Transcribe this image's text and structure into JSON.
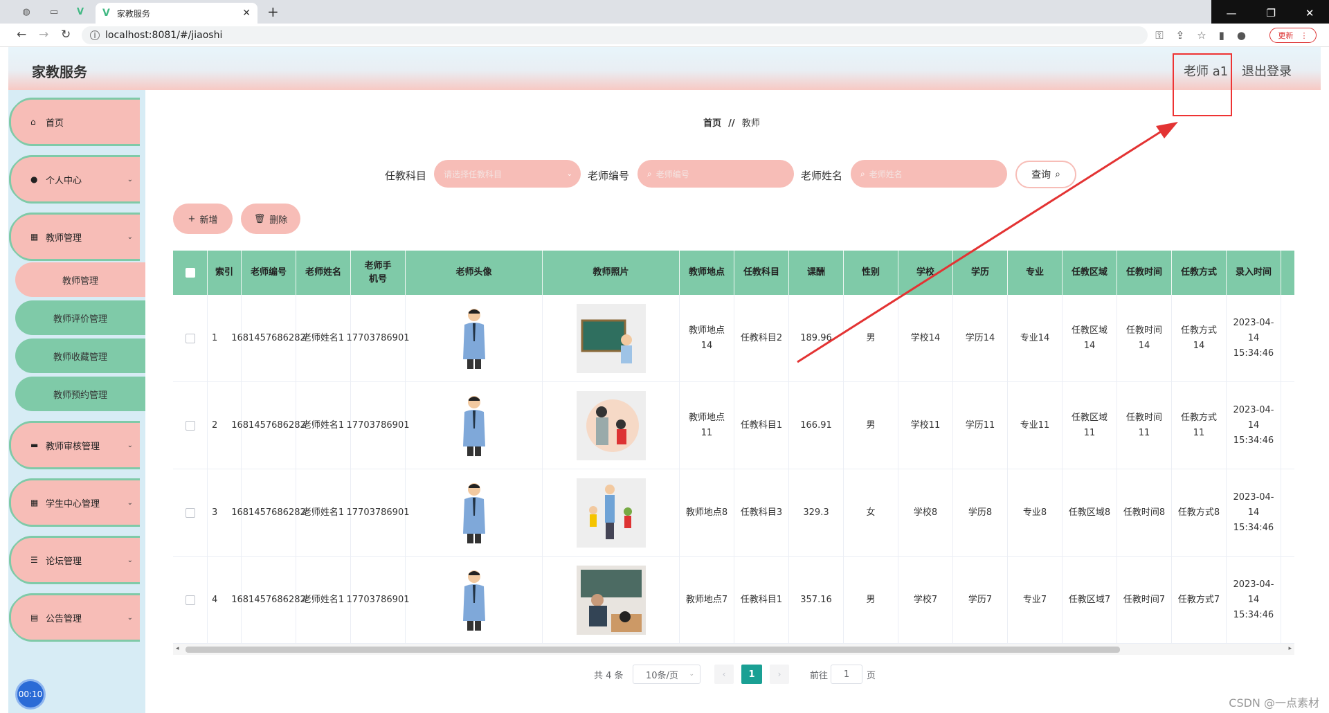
{
  "browser": {
    "tab_title": "家教服务",
    "url": "localhost:8081/#/jiaoshi",
    "update_label": "更新"
  },
  "header": {
    "title": "家教服务",
    "user": "老师 a1",
    "logout": "退出登录"
  },
  "sidebar": {
    "items": [
      {
        "label": "首页"
      },
      {
        "label": "个人中心"
      },
      {
        "label": "教师管理"
      },
      {
        "label": "教师审核管理"
      },
      {
        "label": "学生中心管理"
      },
      {
        "label": "论坛管理"
      },
      {
        "label": "公告管理"
      }
    ],
    "sub_items": [
      {
        "label": "教师管理"
      },
      {
        "label": "教师评价管理"
      },
      {
        "label": "教师收藏管理"
      },
      {
        "label": "教师预约管理"
      }
    ],
    "timer": "00:10"
  },
  "breadcrumb": {
    "home": "首页",
    "sep": "//",
    "current": "教师"
  },
  "search": {
    "subject_label": "任教科目",
    "subject_placeholder": "请选择任教科目",
    "id_label": "老师编号",
    "id_placeholder": "老师编号",
    "name_label": "老师姓名",
    "name_placeholder": "老师姓名",
    "query": "查询"
  },
  "actions": {
    "add": "新增",
    "delete": "删除"
  },
  "table": {
    "headers": [
      "索引",
      "老师编号",
      "老师姓名",
      "老师手机号",
      "老师头像",
      "教师照片",
      "教师地点",
      "任教科目",
      "课酬",
      "性别",
      "学校",
      "学历",
      "专业",
      "任教区域",
      "任教时间",
      "任教方式",
      "录入时间"
    ],
    "rows": [
      {
        "idx": "1",
        "code": "1681457686282",
        "name": "老师姓名1",
        "phone": "17703786901",
        "place": "教师地点14",
        "subject": "任教科目2",
        "fee": "189.96",
        "gender": "男",
        "school": "学校14",
        "edu": "学历14",
        "major": "专业14",
        "area": "任教区域14",
        "time": "任教时间14",
        "mode": "任教方式14",
        "created": "2023-04-14 15:34:46"
      },
      {
        "idx": "2",
        "code": "1681457686282",
        "name": "老师姓名1",
        "phone": "17703786901",
        "place": "教师地点11",
        "subject": "任教科目1",
        "fee": "166.91",
        "gender": "男",
        "school": "学校11",
        "edu": "学历11",
        "major": "专业11",
        "area": "任教区域11",
        "time": "任教时间11",
        "mode": "任教方式11",
        "created": "2023-04-14 15:34:46"
      },
      {
        "idx": "3",
        "code": "1681457686282",
        "name": "老师姓名1",
        "phone": "17703786901",
        "place": "教师地点8",
        "subject": "任教科目3",
        "fee": "329.3",
        "gender": "女",
        "school": "学校8",
        "edu": "学历8",
        "major": "专业8",
        "area": "任教区域8",
        "time": "任教时间8",
        "mode": "任教方式8",
        "created": "2023-04-14 15:34:46"
      },
      {
        "idx": "4",
        "code": "1681457686282",
        "name": "老师姓名1",
        "phone": "17703786901",
        "place": "教师地点7",
        "subject": "任教科目1",
        "fee": "357.16",
        "gender": "男",
        "school": "学校7",
        "edu": "学历7",
        "major": "专业7",
        "area": "任教区域7",
        "time": "任教时间7",
        "mode": "任教方式7",
        "created": "2023-04-14 15:34:46"
      }
    ]
  },
  "pagination": {
    "total": "共 4 条",
    "size": "10条/页",
    "current": "1",
    "goto": "前往",
    "goto_value": "1",
    "page": "页"
  },
  "watermark": "CSDN @一点素材",
  "colors": {
    "accent_pink": "#f7bdb7",
    "accent_green": "#7fcaa8",
    "sidebar_bg": "#d7ecf5",
    "page_active": "#1aa094",
    "annotation": "#e33333"
  }
}
